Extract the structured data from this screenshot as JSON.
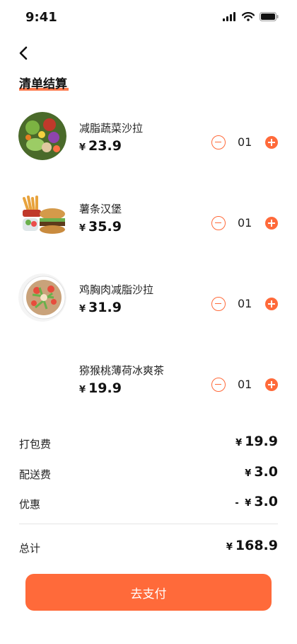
{
  "status_bar": {
    "time": "9:41"
  },
  "header": {
    "title": "清单结算"
  },
  "currency_symbol": "¥",
  "cart": {
    "items": [
      {
        "name": "减脂蔬菜沙拉",
        "price": "23.9",
        "quantity": "01"
      },
      {
        "name": "薯条汉堡",
        "price": "35.9",
        "quantity": "01"
      },
      {
        "name": "鸡胸肉减脂沙拉",
        "price": "31.9",
        "quantity": "01"
      },
      {
        "name": "猕猴桃薄荷冰爽茶",
        "price": "19.9",
        "quantity": "01"
      }
    ]
  },
  "summary": {
    "packing": {
      "label": "打包费",
      "value": "19.9"
    },
    "delivery": {
      "label": "配送费",
      "value": "3.0"
    },
    "discount": {
      "label": "优惠",
      "prefix": "- ",
      "value": "3.0"
    },
    "total": {
      "label": "总计",
      "value": "168.9"
    }
  },
  "pay_button": {
    "label": "去支付"
  },
  "colors": {
    "accent": "#ff6a3a",
    "text": "#222222"
  }
}
